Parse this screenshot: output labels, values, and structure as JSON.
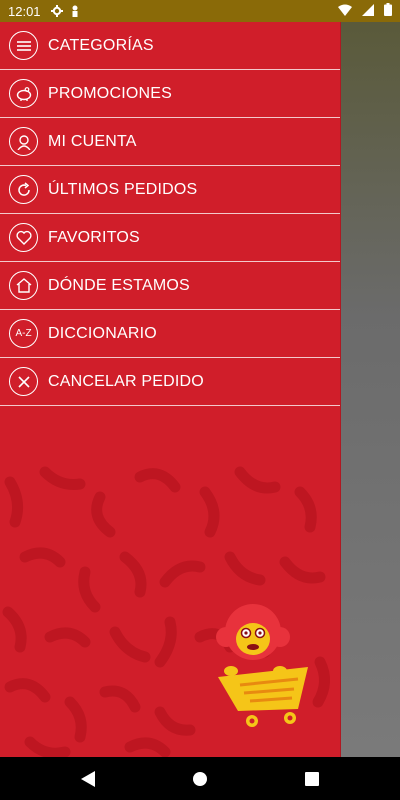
{
  "status_bar": {
    "time": "12:01",
    "left_icons": [
      "gear-icon",
      "person-icon"
    ],
    "right_icons": [
      "wifi-icon",
      "signal-icon",
      "battery-icon"
    ]
  },
  "menu": {
    "items": [
      {
        "label": "CATEGORÍAS",
        "icon": "hamburger-icon"
      },
      {
        "label": "PROMOCIONES",
        "icon": "piggy-bank-icon"
      },
      {
        "label": "MI CUENTA",
        "icon": "user-icon"
      },
      {
        "label": "ÚLTIMOS PEDIDOS",
        "icon": "refresh-icon"
      },
      {
        "label": "FAVORITOS",
        "icon": "heart-icon"
      },
      {
        "label": "DÓNDE ESTAMOS",
        "icon": "home-icon"
      },
      {
        "label": "DICCIONARIO",
        "icon": "a-z-icon",
        "icon_text": "A-Z"
      },
      {
        "label": "CANCELAR PEDIDO",
        "icon": "close-icon"
      }
    ]
  },
  "colors": {
    "drawer_bg": "#d01e2a",
    "divider": "#f3c9cc",
    "status_bar": "#8a6a08",
    "mascot_yellow": "#f5c518"
  },
  "nav_bar": {
    "buttons": [
      "back-icon",
      "home-icon",
      "recents-icon"
    ]
  }
}
